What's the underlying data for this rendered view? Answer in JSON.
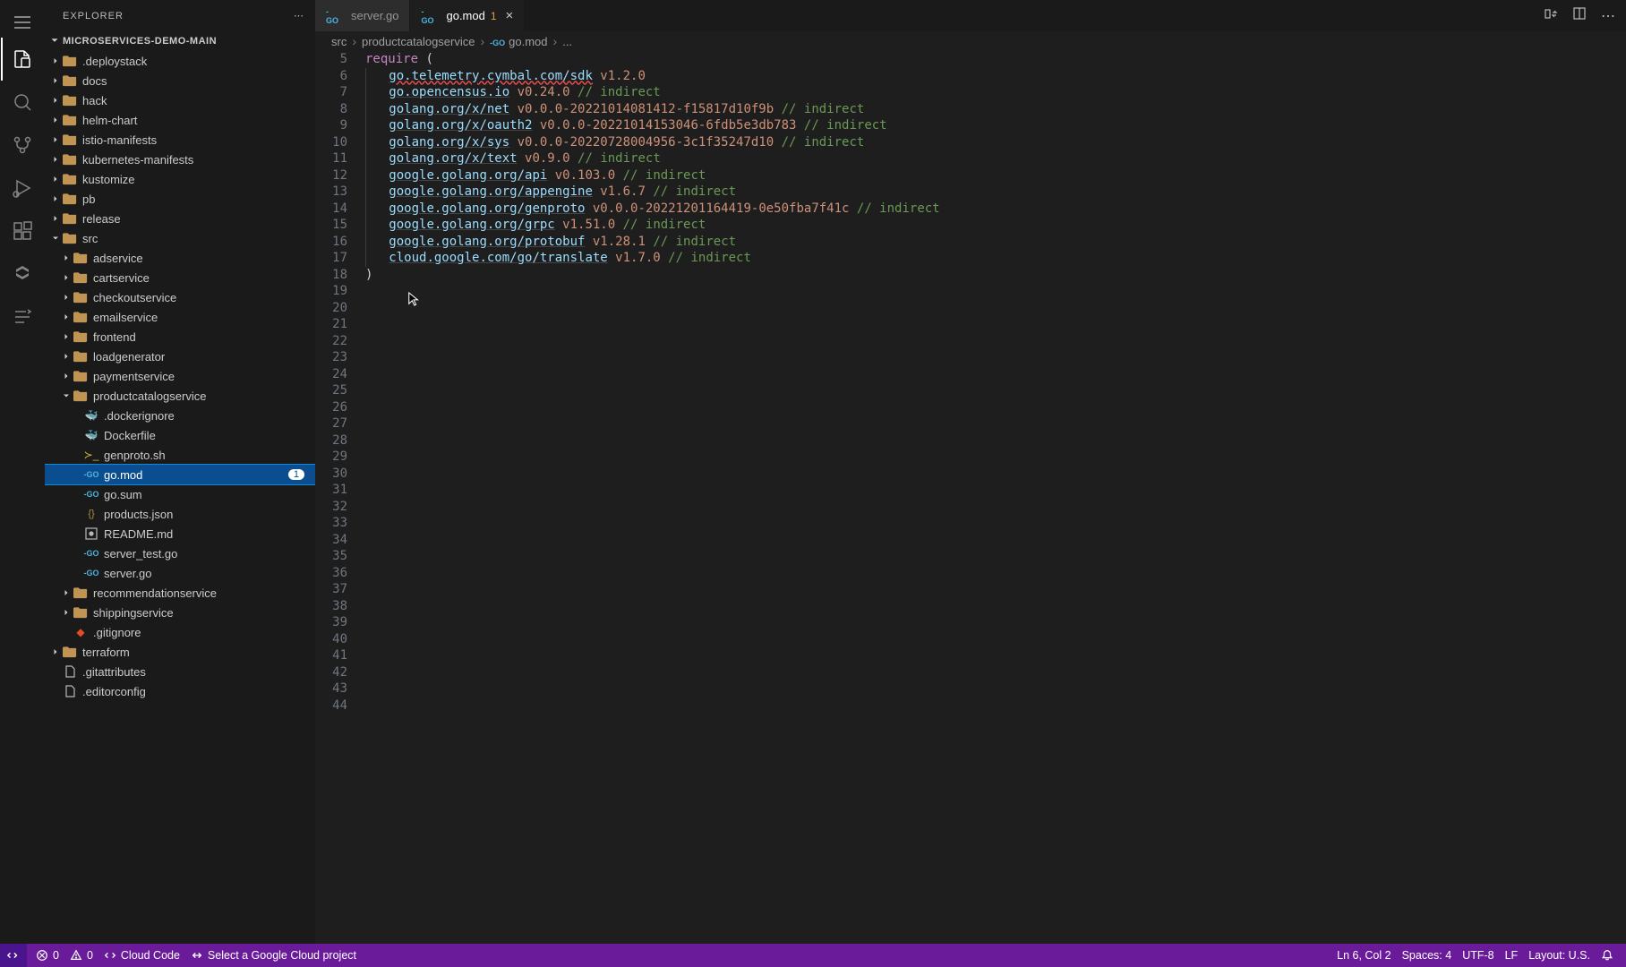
{
  "sidebar": {
    "title": "EXPLORER",
    "project": "MICROSERVICES-DEMO-MAIN"
  },
  "tree": [
    {
      "indent": 1,
      "chev": "right",
      "icon": "folder",
      "label": ".deploystack"
    },
    {
      "indent": 1,
      "chev": "right",
      "icon": "folder",
      "label": "docs"
    },
    {
      "indent": 1,
      "chev": "right",
      "icon": "folder",
      "label": "hack"
    },
    {
      "indent": 1,
      "chev": "right",
      "icon": "folder",
      "label": "helm-chart"
    },
    {
      "indent": 1,
      "chev": "right",
      "icon": "folder",
      "label": "istio-manifests"
    },
    {
      "indent": 1,
      "chev": "right",
      "icon": "folder",
      "label": "kubernetes-manifests"
    },
    {
      "indent": 1,
      "chev": "right",
      "icon": "folder",
      "label": "kustomize"
    },
    {
      "indent": 1,
      "chev": "right",
      "icon": "folder",
      "label": "pb"
    },
    {
      "indent": 1,
      "chev": "right",
      "icon": "folder",
      "label": "release"
    },
    {
      "indent": 1,
      "chev": "down",
      "icon": "folder",
      "label": "src"
    },
    {
      "indent": 2,
      "chev": "right",
      "icon": "folder",
      "label": "adservice"
    },
    {
      "indent": 2,
      "chev": "right",
      "icon": "folder",
      "label": "cartservice"
    },
    {
      "indent": 2,
      "chev": "right",
      "icon": "folder",
      "label": "checkoutservice"
    },
    {
      "indent": 2,
      "chev": "right",
      "icon": "folder",
      "label": "emailservice"
    },
    {
      "indent": 2,
      "chev": "right",
      "icon": "folder",
      "label": "frontend"
    },
    {
      "indent": 2,
      "chev": "right",
      "icon": "folder",
      "label": "loadgenerator"
    },
    {
      "indent": 2,
      "chev": "right",
      "icon": "folder",
      "label": "paymentservice"
    },
    {
      "indent": 2,
      "chev": "down",
      "icon": "folder",
      "label": "productcatalogservice"
    },
    {
      "indent": 3,
      "chev": "none",
      "icon": "docker",
      "label": ".dockerignore"
    },
    {
      "indent": 3,
      "chev": "none",
      "icon": "docker",
      "label": "Dockerfile"
    },
    {
      "indent": 3,
      "chev": "none",
      "icon": "sh",
      "label": "genproto.sh"
    },
    {
      "indent": 3,
      "chev": "none",
      "icon": "go",
      "label": "go.mod",
      "selected": true,
      "badge": "1"
    },
    {
      "indent": 3,
      "chev": "none",
      "icon": "go",
      "label": "go.sum"
    },
    {
      "indent": 3,
      "chev": "none",
      "icon": "json",
      "label": "products.json"
    },
    {
      "indent": 3,
      "chev": "none",
      "icon": "md",
      "label": "README.md"
    },
    {
      "indent": 3,
      "chev": "none",
      "icon": "go",
      "label": "server_test.go"
    },
    {
      "indent": 3,
      "chev": "none",
      "icon": "go",
      "label": "server.go"
    },
    {
      "indent": 2,
      "chev": "right",
      "icon": "folder",
      "label": "recommendationservice"
    },
    {
      "indent": 2,
      "chev": "right",
      "icon": "folder",
      "label": "shippingservice"
    },
    {
      "indent": 2,
      "chev": "none",
      "icon": "git",
      "label": ".gitignore"
    },
    {
      "indent": 1,
      "chev": "right",
      "icon": "folder",
      "label": "terraform"
    },
    {
      "indent": 1,
      "chev": "none",
      "icon": "generic",
      "label": ".gitattributes"
    },
    {
      "indent": 1,
      "chev": "none",
      "icon": "generic",
      "label": ".editorconfig"
    }
  ],
  "tabs": [
    {
      "icon": "go",
      "label": "server.go",
      "active": false
    },
    {
      "icon": "go",
      "label": "go.mod",
      "active": true,
      "badge": "1",
      "closable": true
    }
  ],
  "breadcrumbs": [
    "src",
    "productcatalogservice",
    "go.mod",
    "..."
  ],
  "editor": {
    "startLine": 5,
    "endLine": 44,
    "lines": [
      {
        "n": 5,
        "segs": [
          {
            "t": "require",
            "c": "kw"
          },
          {
            "t": " (",
            "c": ""
          }
        ]
      },
      {
        "n": 6,
        "indent": 1,
        "segs": [
          {
            "t": "go.telemetry.cymbal.com/sdk",
            "c": "pkg err"
          },
          {
            "t": " v1.2.0",
            "c": "ver"
          }
        ]
      },
      {
        "n": 7,
        "indent": 1,
        "segs": [
          {
            "t": "go.opencensus.io",
            "c": "pkg"
          },
          {
            "t": " v0.24.0",
            "c": "ver"
          },
          {
            "t": " // indirect",
            "c": "com"
          }
        ]
      },
      {
        "n": 8,
        "indent": 1,
        "segs": [
          {
            "t": "golang.org/x/net",
            "c": "pkg"
          },
          {
            "t": " v0.0.0-20221014081412-f15817d10f9b",
            "c": "ver"
          },
          {
            "t": " // indirect",
            "c": "com"
          }
        ]
      },
      {
        "n": 9,
        "indent": 1,
        "segs": [
          {
            "t": "golang.org/x/oauth2",
            "c": "pkg"
          },
          {
            "t": " v0.0.0-20221014153046-6fdb5e3db783",
            "c": "ver"
          },
          {
            "t": " // indirect",
            "c": "com"
          }
        ]
      },
      {
        "n": 10,
        "indent": 1,
        "segs": [
          {
            "t": "golang.org/x/sys",
            "c": "pkg"
          },
          {
            "t": " v0.0.0-20220728004956-3c1f35247d10",
            "c": "ver"
          },
          {
            "t": " // indirect",
            "c": "com"
          }
        ]
      },
      {
        "n": 11,
        "indent": 1,
        "segs": [
          {
            "t": "golang.org/x/text",
            "c": "pkg"
          },
          {
            "t": " v0.9.0",
            "c": "ver"
          },
          {
            "t": " // indirect",
            "c": "com"
          }
        ]
      },
      {
        "n": 12,
        "indent": 1,
        "segs": [
          {
            "t": "google.golang.org/api",
            "c": "pkg"
          },
          {
            "t": " v0.103.0",
            "c": "ver"
          },
          {
            "t": " // indirect",
            "c": "com"
          }
        ]
      },
      {
        "n": 13,
        "indent": 1,
        "segs": [
          {
            "t": "google.golang.org/appengine",
            "c": "pkg"
          },
          {
            "t": " v1.6.7",
            "c": "ver"
          },
          {
            "t": " // indirect",
            "c": "com"
          }
        ]
      },
      {
        "n": 14,
        "indent": 1,
        "segs": [
          {
            "t": "google.golang.org/genproto",
            "c": "pkg"
          },
          {
            "t": " v0.0.0-20221201164419-0e50fba7f41c",
            "c": "ver"
          },
          {
            "t": " // indirect",
            "c": "com"
          }
        ]
      },
      {
        "n": 15,
        "indent": 1,
        "segs": [
          {
            "t": "google.golang.org/grpc",
            "c": "pkg"
          },
          {
            "t": " v1.51.0",
            "c": "ver"
          },
          {
            "t": " // indirect",
            "c": "com"
          }
        ]
      },
      {
        "n": 16,
        "indent": 1,
        "segs": [
          {
            "t": "google.golang.org/protobuf",
            "c": "pkg"
          },
          {
            "t": " v1.28.1",
            "c": "ver"
          },
          {
            "t": " // indirect",
            "c": "com"
          }
        ]
      },
      {
        "n": 17,
        "indent": 1,
        "segs": [
          {
            "t": "cloud.google.com/go/translate",
            "c": "pkg"
          },
          {
            "t": " v1.7.0",
            "c": "ver"
          },
          {
            "t": " // indirect",
            "c": "com"
          }
        ]
      },
      {
        "n": 18,
        "segs": [
          {
            "t": ")",
            "c": ""
          }
        ]
      }
    ]
  },
  "status": {
    "errors": "0",
    "warnings": "0",
    "cloudcode": "Cloud Code",
    "project_select": "Select a Google Cloud project",
    "pos": "Ln 6, Col 2",
    "spaces": "Spaces: 4",
    "encoding": "UTF-8",
    "eol": "LF",
    "layout": "Layout: U.S."
  }
}
